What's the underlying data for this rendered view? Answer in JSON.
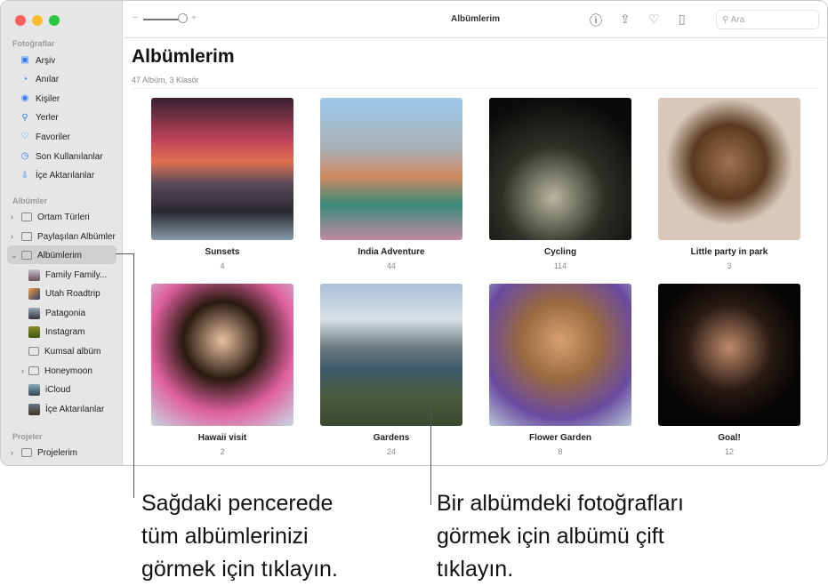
{
  "window": {
    "title": "Albümlerim",
    "search_placeholder": "Ara"
  },
  "sidebar": {
    "sections": [
      "Fotoğraflar",
      "Albümler",
      "Projeler"
    ],
    "library": [
      {
        "label": "Arşiv",
        "icon": "library-icon"
      },
      {
        "label": "Anılar",
        "icon": "memories-icon"
      },
      {
        "label": "Kişiler",
        "icon": "people-icon"
      },
      {
        "label": "Yerler",
        "icon": "places-icon"
      },
      {
        "label": "Favoriler",
        "icon": "heart-icon"
      },
      {
        "label": "Son Kullanılanlar",
        "icon": "clock-icon"
      },
      {
        "label": "İçe Aktarılanlar",
        "icon": "import-icon"
      }
    ],
    "albums": [
      {
        "label": "Ortam Türleri"
      },
      {
        "label": "Paylaşılan Albümler"
      },
      {
        "label": "Albümlerim"
      }
    ],
    "my_albums": [
      {
        "label": "Family Family..."
      },
      {
        "label": "Utah Roadtrip"
      },
      {
        "label": "Patagonia"
      },
      {
        "label": "Instagram"
      },
      {
        "label": "Kumsal albüm"
      },
      {
        "label": "Honeymoon"
      },
      {
        "label": "iCloud"
      },
      {
        "label": "İçe Aktarılanlar"
      }
    ],
    "projects": [
      {
        "label": "Projelerim"
      }
    ]
  },
  "main": {
    "title": "Albümlerim",
    "subtitle": "47 Albüm, 3 Klasör",
    "albums": [
      {
        "name": "Sunsets",
        "count": "4"
      },
      {
        "name": "India Adventure",
        "count": "44"
      },
      {
        "name": "Cycling",
        "count": "114"
      },
      {
        "name": "Little party in park",
        "count": "3"
      },
      {
        "name": "Hawaii visit",
        "count": "2"
      },
      {
        "name": "Gardens",
        "count": "24"
      },
      {
        "name": "Flower Garden",
        "count": "8"
      },
      {
        "name": "Goal!",
        "count": "12"
      }
    ]
  },
  "callouts": {
    "left": [
      "Sağdaki pencerede",
      "tüm albümlerinizi",
      "görmek için tıklayın."
    ],
    "right": [
      "Bir albümdeki fotoğrafları",
      "görmek için albümü çift",
      "tıklayın."
    ]
  },
  "colors": {
    "accent": "#2f7df6",
    "selection": "#d0d0d0"
  }
}
